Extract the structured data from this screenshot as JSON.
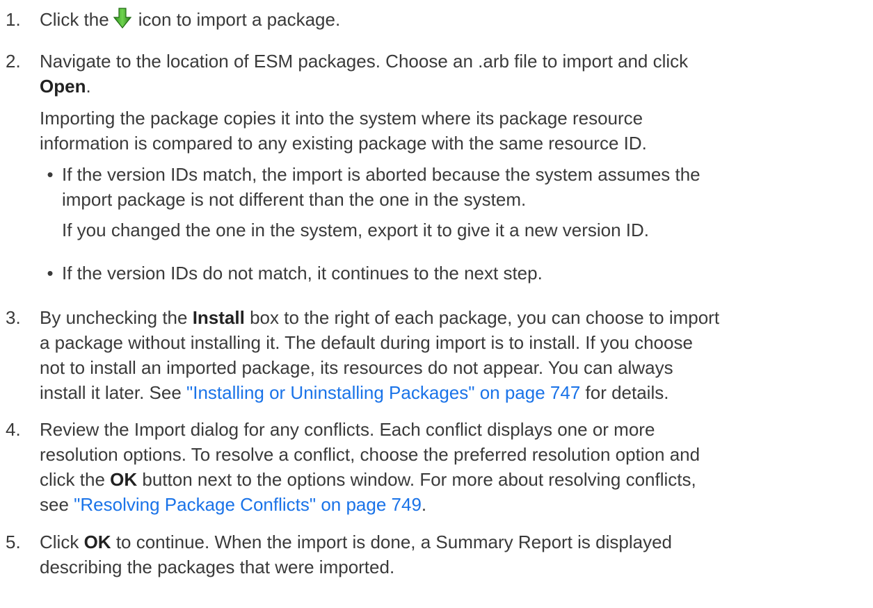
{
  "steps": [
    {
      "number": "1.",
      "text_before_icon": "Click the",
      "icon": "green-down-arrow-import-icon",
      "text_after_icon": "icon to import a package."
    },
    {
      "number": "2.",
      "line1": "Navigate to the location of ESM packages. Choose an .arb file to import and click",
      "open_label": "Open",
      "open_suffix": ".",
      "para_line1": "Importing the package copies it into the system where its package resource",
      "para_line2": "information is compared to any existing package with the same resource ID.",
      "bullets": [
        {
          "line1": "If the version IDs match, the import is aborted because the system assumes the",
          "line2": "import package is not different than the one in the system.",
          "note": "If you changed the one in the system, export it to give it a new version ID."
        },
        {
          "line1": "If the version IDs do not match, it continues to the next step."
        }
      ]
    },
    {
      "number": "3.",
      "l1_before": "By unchecking the",
      "l1_bold": "Install",
      "l1_after": "box to the right of each package, you can choose to import",
      "line2": "a package without installing it. The default during import is to install. If you choose",
      "line3": "not to install an imported package, its resources do not appear. You can always",
      "l4_before": "install it later. See",
      "l4_link": "\"Installing or Uninstalling Packages\" on page 747",
      "l4_after": "for details."
    },
    {
      "number": "4.",
      "line1": "Review the Import dialog for any conflicts. Each conflict displays one or more",
      "line2": "resolution options. To resolve a conflict, choose the preferred resolution option and",
      "l3_before": "click the",
      "l3_bold": "OK",
      "l3_after": "button next to the options window. For more about resolving conflicts,",
      "l4_before": "see",
      "l4_link": "\"Resolving Package Conflicts\" on page 749",
      "l4_after": "."
    },
    {
      "number": "5.",
      "l1_before": "Click",
      "l1_bold": "OK",
      "l1_after": "to continue. When the import is done, a Summary Report is displayed",
      "line2": "describing the packages that were imported."
    }
  ],
  "colors": {
    "text": "#3a3a3a",
    "link": "#1a73e8",
    "icon_green": "#3cae2c"
  }
}
